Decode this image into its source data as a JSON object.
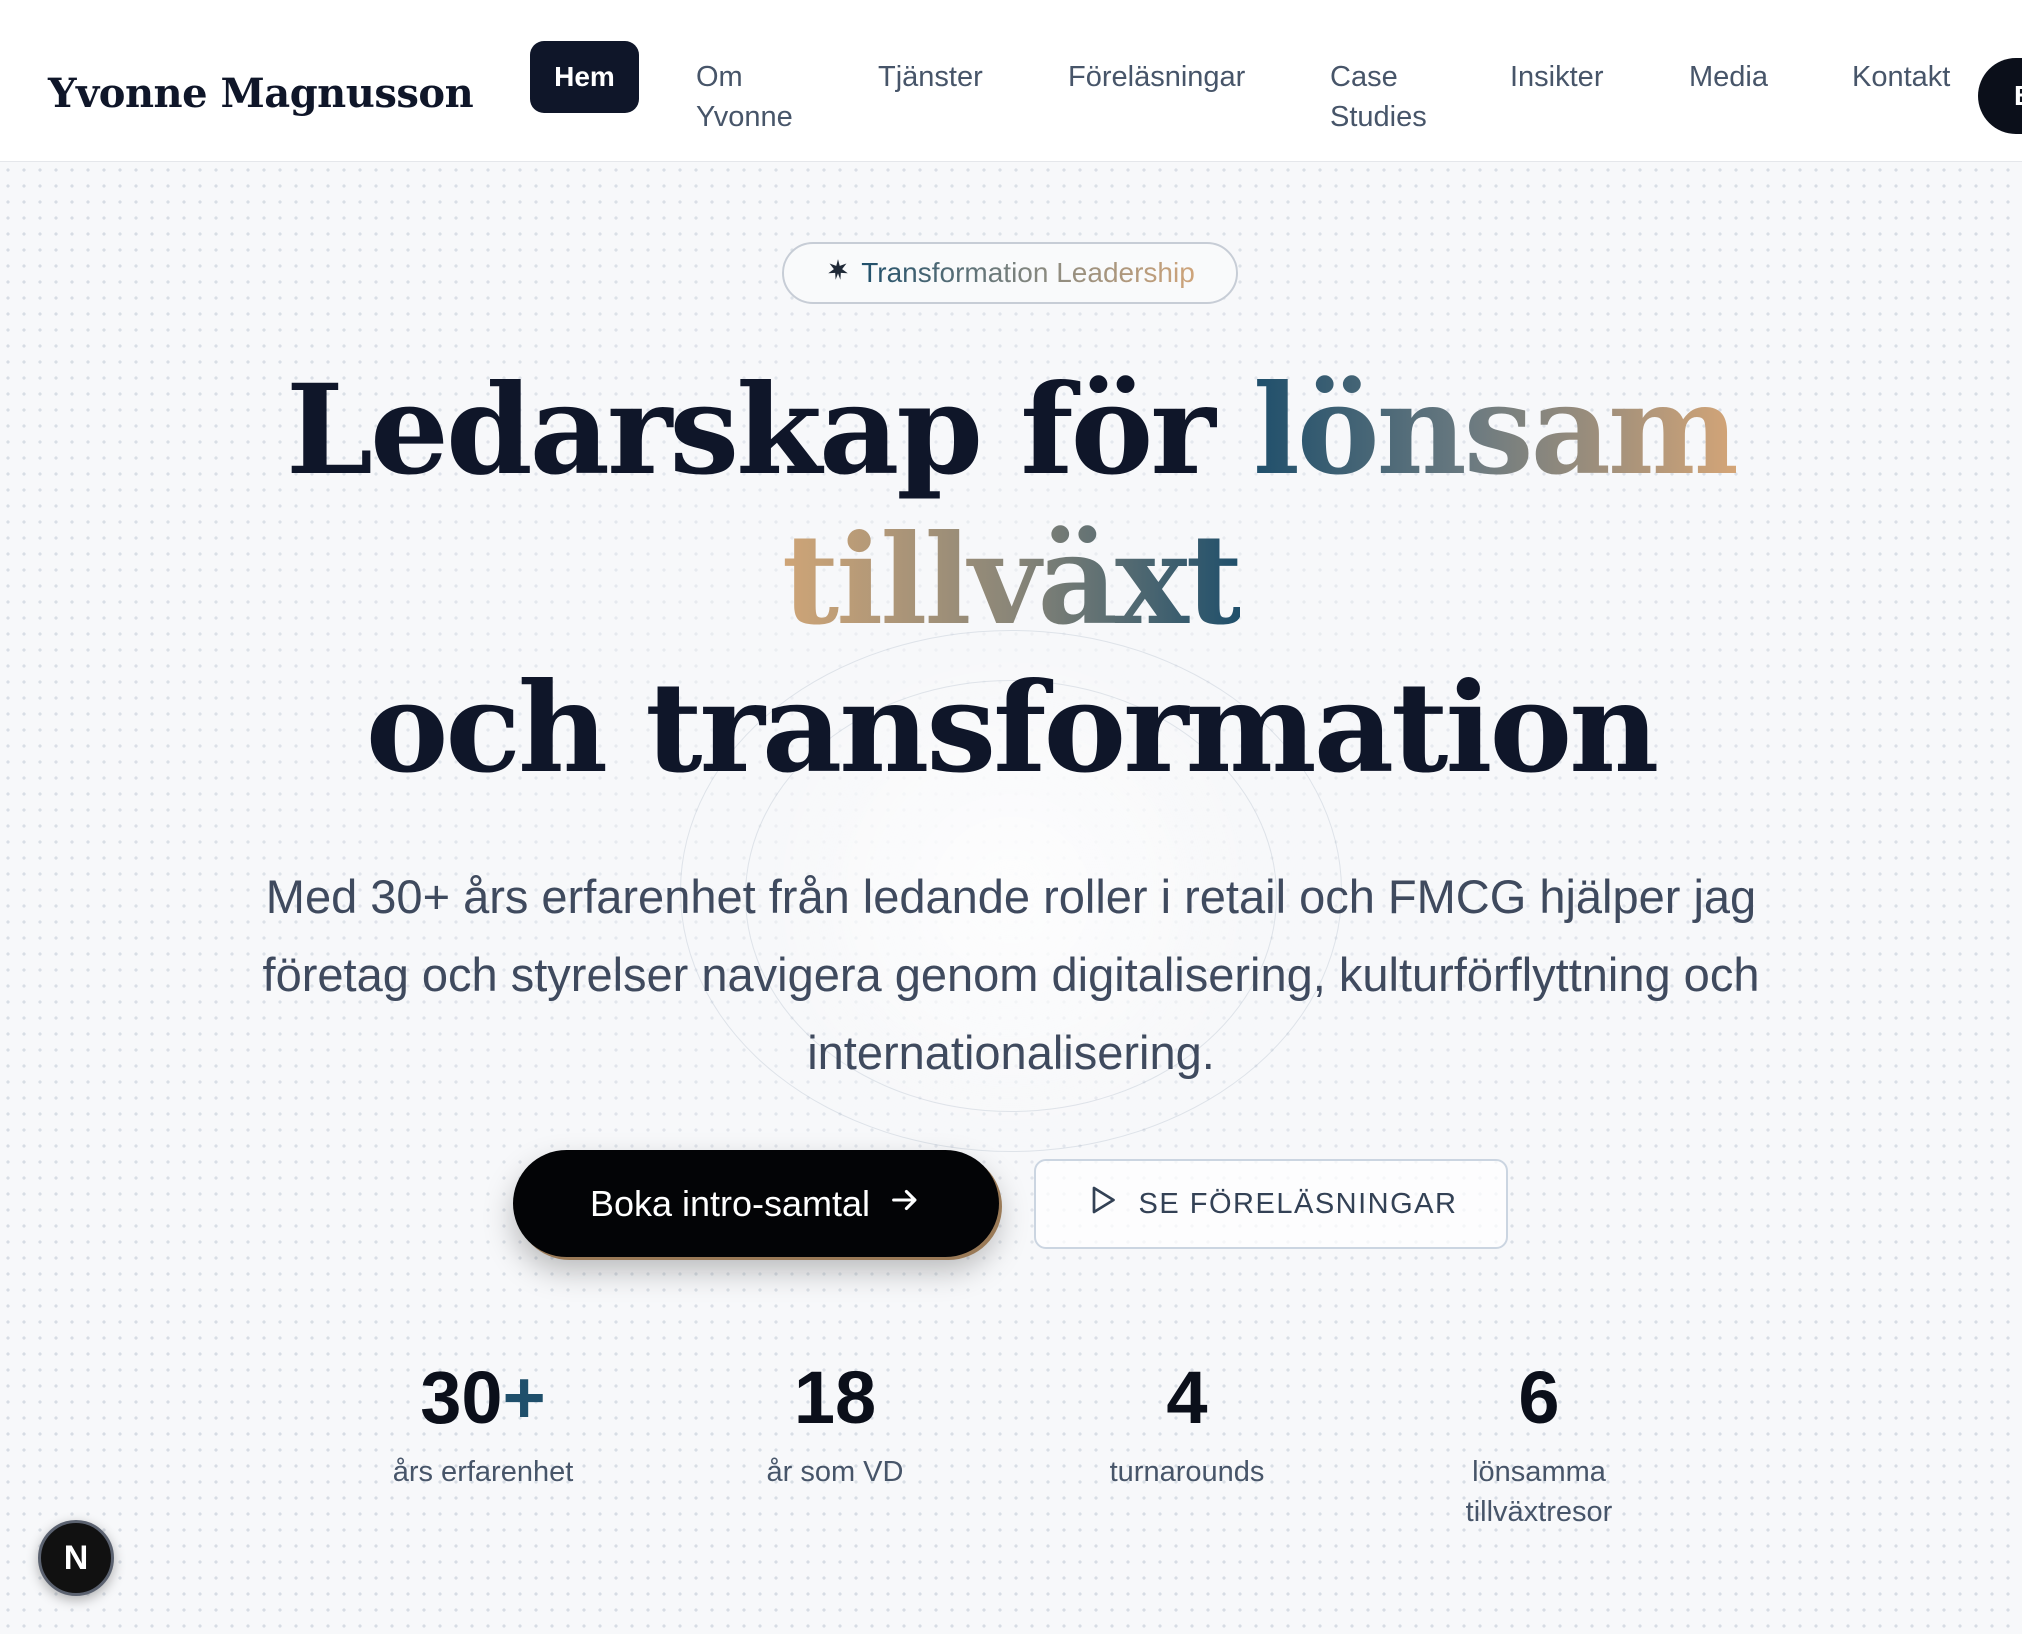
{
  "brand": "Yvonne Magnusson",
  "nav": {
    "items": [
      "Hem",
      "Om\nYvonne",
      "Tjänster",
      "Föreläsningar",
      "Case\nStudies",
      "Insikter",
      "Media",
      "Kontakt"
    ],
    "active": "Hem",
    "cta_label": "B"
  },
  "hero": {
    "badge": "Transformation Leadership",
    "badge_icon": "sparkle-icon",
    "title_line1_plain": "Ledarskap för ",
    "title_line1_accent": "lönsam",
    "title_line2_accent": "tillväxt",
    "title_line3": "och transformation",
    "subtitle": "Med 30+ års erfarenhet från ledande roller i retail och FMCG hjälper jag företag och styrelser navigera genom digitalisering, kulturförflyttning och internationalisering.",
    "primary_button": "Boka intro-samtal",
    "primary_button_icon": "arrow-right-icon",
    "secondary_button": "SE FÖRELÄSNINGAR",
    "secondary_button_icon": "play-icon"
  },
  "stats": [
    {
      "value": "30",
      "suffix": "+",
      "label": "års erfarenhet"
    },
    {
      "value": "18",
      "suffix": "",
      "label": "år som VD"
    },
    {
      "value": "4",
      "suffix": "",
      "label": "turnarounds"
    },
    {
      "value": "6",
      "suffix": "",
      "label": "lönsamma tillväxtresor"
    }
  ],
  "dev_indicator": "N",
  "colors": {
    "navy": "#0f1629",
    "accent_blue": "#1f4f6b",
    "accent_gold": "#cfa577",
    "background": "#f7f8fa"
  }
}
